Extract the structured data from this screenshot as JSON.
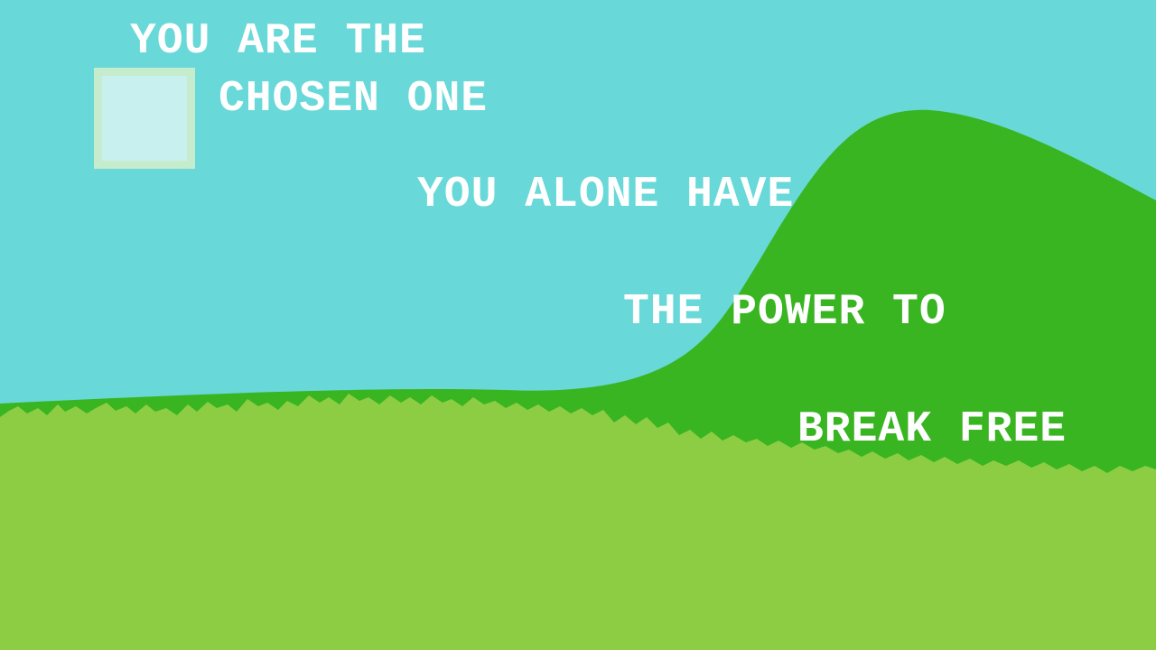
{
  "story": {
    "lines": [
      "YOU ARE THE",
      "CHOSEN ONE",
      "YOU ALONE HAVE",
      "THE POWER TO",
      "BREAK FREE"
    ]
  },
  "colors": {
    "sky": "#68d8d8",
    "hill": "#38b520",
    "grass": "#8ccd44",
    "text": "#ffffff",
    "player_fill": "#c8f0ee",
    "player_border": "#c6ecce"
  }
}
